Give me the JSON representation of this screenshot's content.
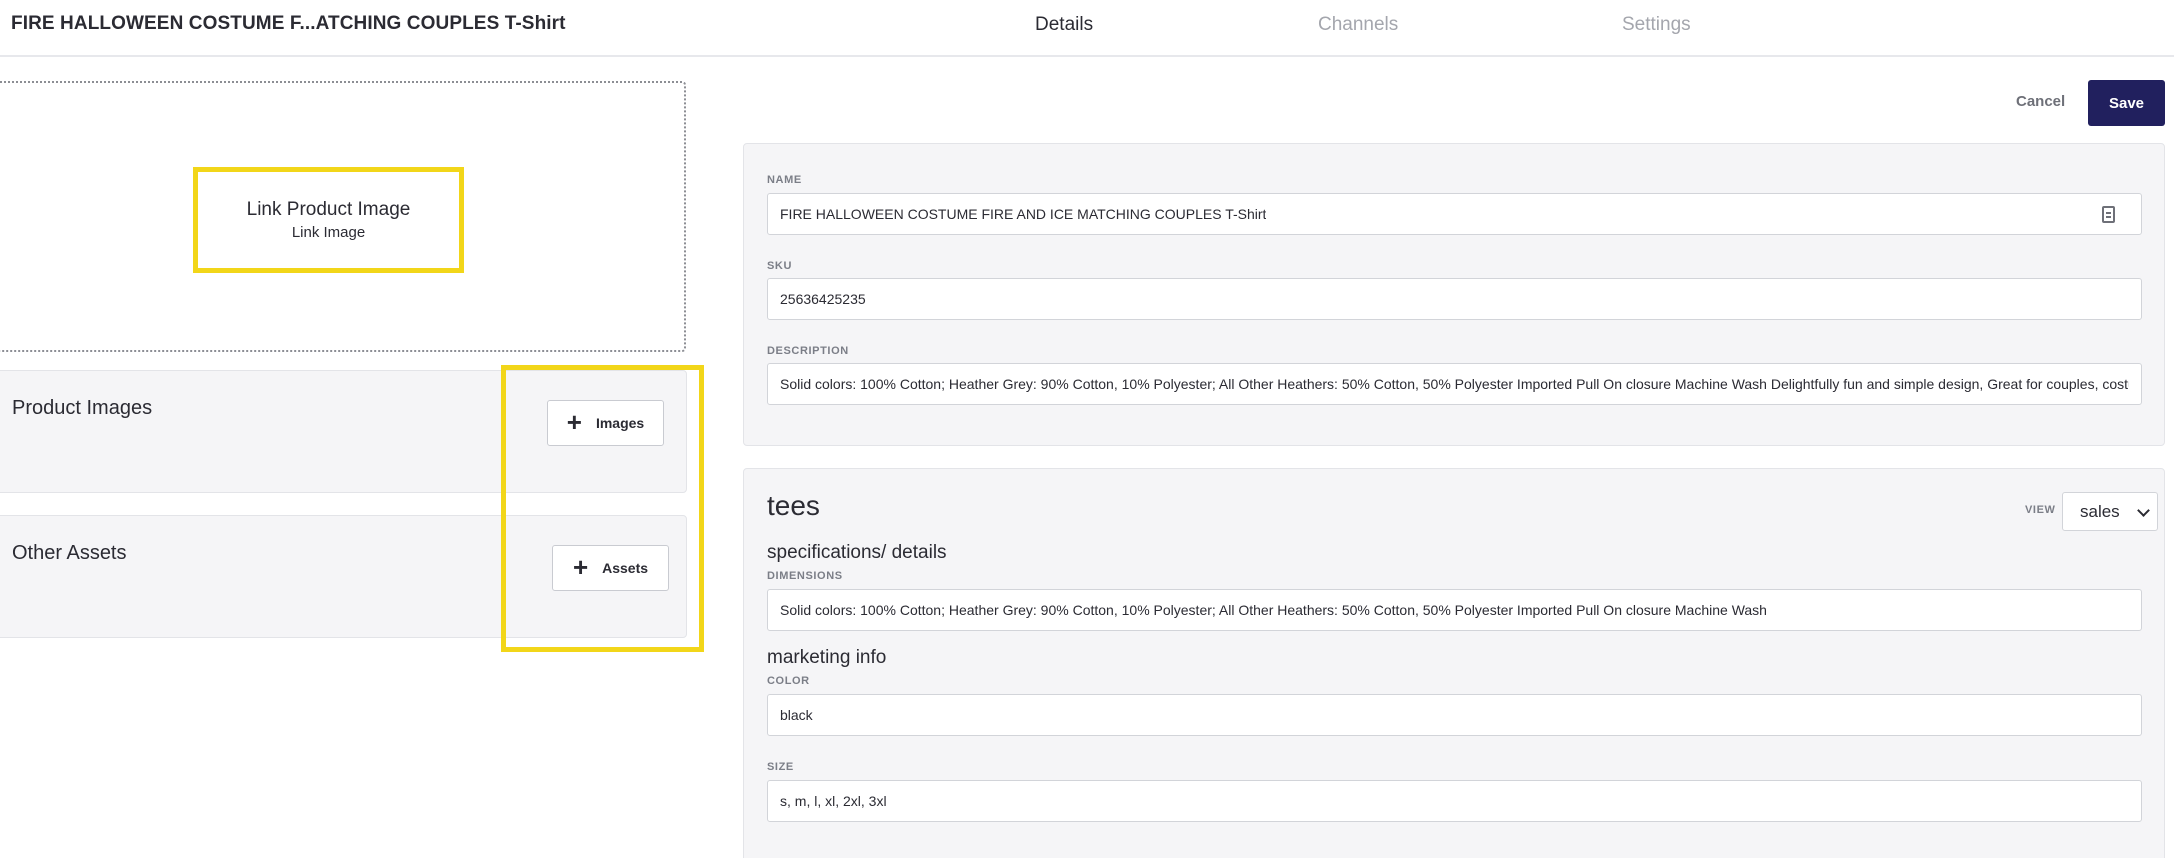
{
  "header": {
    "title": "FIRE HALLOWEEN COSTUME F...ATCHING COUPLES T-Shirt",
    "tabs": [
      {
        "label": "Details",
        "active": true
      },
      {
        "label": "Channels",
        "active": false
      },
      {
        "label": "Settings",
        "active": false
      }
    ]
  },
  "link_image": {
    "title": "Link Product Image",
    "link_label": "Link Image"
  },
  "product_images": {
    "title": "Product Images",
    "button_label": "Images",
    "button_icon": "plus-icon"
  },
  "other_assets": {
    "title": "Other Assets",
    "button_label": "Assets",
    "button_icon": "plus-icon"
  },
  "actions": {
    "cancel_label": "Cancel",
    "save_label": "Save"
  },
  "fields": {
    "name": {
      "label": "NAME",
      "value": "FIRE HALLOWEEN COSTUME FIRE AND ICE MATCHING COUPLES T-Shirt",
      "icon": "clipboard-icon"
    },
    "sku": {
      "label": "SKU",
      "value": "25636425235"
    },
    "description": {
      "label": "DESCRIPTION",
      "value": "Solid colors: 100% Cotton; Heather Grey: 90% Cotton, 10% Polyester; All Other Heathers: 50% Cotton, 50% Polyester Imported Pull On closure Machine Wash Delightfully fun and simple design, Great for couples, costume"
    }
  },
  "tees": {
    "title": "tees",
    "view_label": "VIEW",
    "view_value": "sales",
    "specs_title": "specifications/ details",
    "dimensions": {
      "label": "DIMENSIONS",
      "value": "Solid colors: 100% Cotton; Heather Grey: 90% Cotton, 10% Polyester; All Other Heathers: 50% Cotton, 50% Polyester Imported Pull On closure Machine Wash"
    },
    "marketing_title": "marketing info",
    "color": {
      "label": "COLOR",
      "value": "black"
    },
    "size": {
      "label": "SIZE",
      "value": "s, m, l, xl, 2xl, 3xl"
    }
  },
  "colors": {
    "highlight": "#f2d619",
    "save_button": "#21205e",
    "panel_bg": "#f5f5f7"
  }
}
